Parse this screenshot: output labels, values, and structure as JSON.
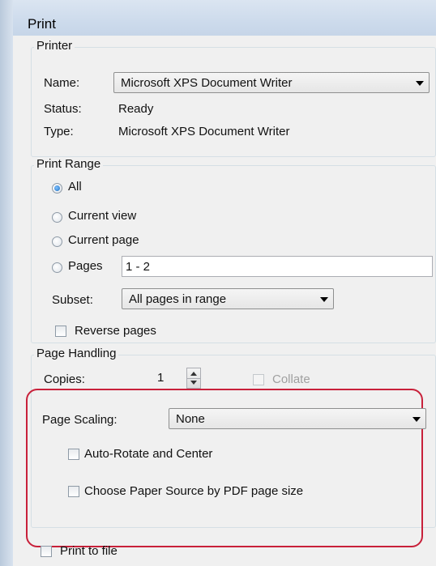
{
  "window": {
    "title": "Print"
  },
  "printer": {
    "legend": "Printer",
    "name_label": "Name:",
    "name_value": "Microsoft XPS Document Writer",
    "status_label": "Status:",
    "status_value": "Ready",
    "type_label": "Type:",
    "type_value": "Microsoft XPS Document Writer"
  },
  "print_range": {
    "legend": "Print Range",
    "options": [
      {
        "label": "All",
        "selected": true
      },
      {
        "label": "Current view",
        "selected": false
      },
      {
        "label": "Current page",
        "selected": false
      },
      {
        "label": "Pages",
        "selected": false
      }
    ],
    "pages_value": "1 - 2",
    "subset_label": "Subset:",
    "subset_value": "All pages in range",
    "reverse_label": "Reverse pages"
  },
  "page_handling": {
    "legend": "Page Handling",
    "copies_label": "Copies:",
    "copies_value": "1",
    "collate_label": "Collate",
    "scaling_label": "Page Scaling:",
    "scaling_value": "None",
    "auto_rotate_label": "Auto-Rotate and Center",
    "paper_source_label": "Choose Paper Source by PDF page size"
  },
  "print_to_file_label": "Print to file",
  "colors": {
    "highlight": "#c8203a",
    "title_bar": "#cddbec"
  }
}
